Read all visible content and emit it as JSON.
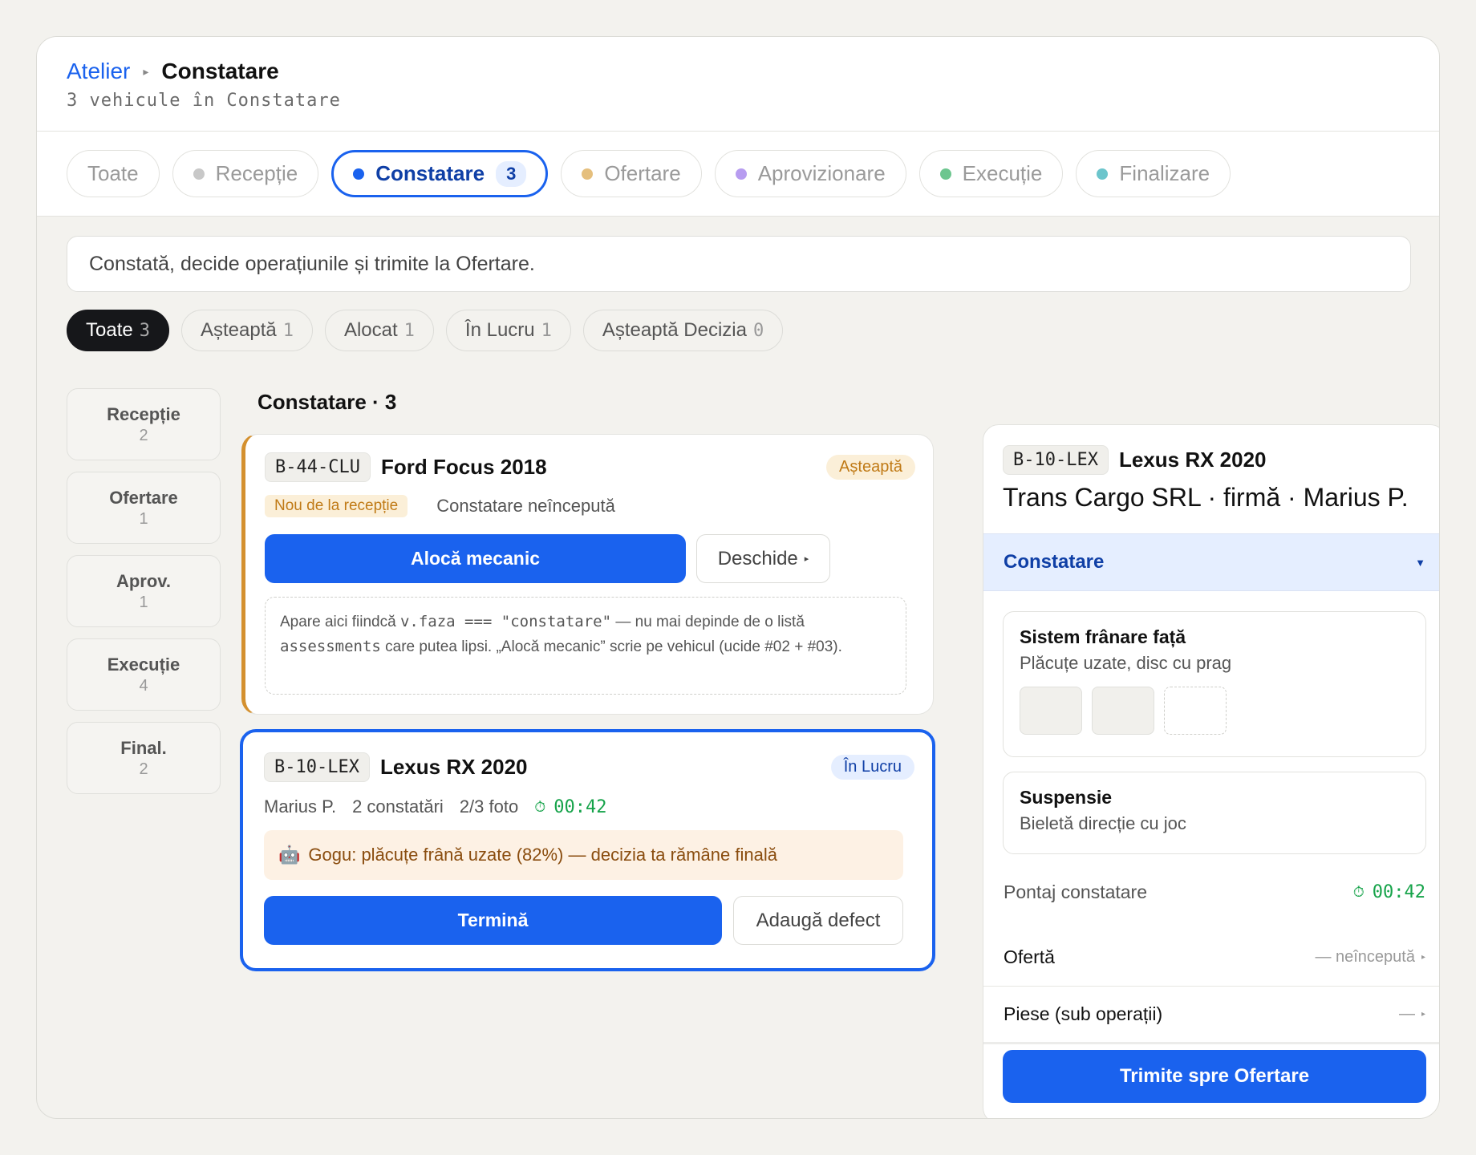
{
  "breadcrumb": {
    "root": "Atelier",
    "current": "Constatare"
  },
  "subtitle": "3 vehicule în Constatare",
  "phase_tabs": [
    {
      "label": "Toate",
      "dot": null
    },
    {
      "label": "Recepție",
      "dot": "#c8c8c8"
    },
    {
      "label": "Constatare",
      "count": "3",
      "dot": "#1a62ee",
      "active": true
    },
    {
      "label": "Ofertare",
      "dot": "#e5bf7d"
    },
    {
      "label": "Aprovizionare",
      "dot": "#b79cf0"
    },
    {
      "label": "Execuție",
      "dot": "#6dc68f"
    },
    {
      "label": "Finalizare",
      "dot": "#6cc5cc"
    }
  ],
  "hint": "Constată, decide operațiunile și trimite la Ofertare.",
  "filters": [
    {
      "label": "Toate",
      "count": "3"
    },
    {
      "label": "Așteaptă",
      "count": "1"
    },
    {
      "label": "Alocat",
      "count": "1"
    },
    {
      "label": "În Lucru",
      "count": "1"
    },
    {
      "label": "Așteaptă Decizia",
      "count": "0"
    }
  ],
  "rail": [
    {
      "label": "Recepție",
      "count": "2"
    },
    {
      "label": "Ofertare",
      "count": "1"
    },
    {
      "label": "Aprov.",
      "count": "1"
    },
    {
      "label": "Execuție",
      "count": "4"
    },
    {
      "label": "Final.",
      "count": "2"
    }
  ],
  "column_title": "Constatare · 3",
  "card1": {
    "plate": "B-44-CLU",
    "title": "Ford Focus 2018",
    "status": "Așteaptă",
    "tag": "Nou de la recepție",
    "state": "Constatare neîncepută",
    "primary_btn": "Alocă mecanic",
    "secondary_btn": "Deschide",
    "note_1": "Apare aici fiindcă ",
    "note_code_1": "v.faza === \"constatare\"",
    "note_2": " — nu mai depinde de o listă ",
    "note_code_2": "assessments",
    "note_3": " care putea lipsi. „Alocă mecanic” scrie pe vehicul (ucide #02 + #03)."
  },
  "card2": {
    "plate": "B-10-LEX",
    "title": "Lexus RX 2020",
    "status": "În Lucru",
    "mechanic": "Marius P.",
    "findings": "2 constatări",
    "photos": "2/3 foto",
    "timer": "00:42",
    "ai_emoji": "🤖",
    "ai_text": "Gogu: plăcuțe frână uzate (82%) — decizia ta rămâne finală",
    "primary_btn": "Termină",
    "secondary_btn": "Adaugă defect"
  },
  "detail": {
    "plate": "B-10-LEX",
    "title": "Lexus RX 2020",
    "client": "Trans Cargo SRL · firmă · Marius P.",
    "section": "Constatare",
    "ops": [
      {
        "title": "Sistem frânare față",
        "desc": "Plăcuțe uzate, disc cu prag"
      },
      {
        "title": "Suspensie",
        "desc": "Bieletă direcție cu joc"
      }
    ],
    "timer_label": "Pontaj constatare",
    "timer": "00:42",
    "offer_label": "Ofertă",
    "offer_value": "— neîncepută",
    "parts_label": "Piese (sub operații)",
    "parts_value": "—",
    "submit_btn": "Trimite spre Ofertare"
  }
}
